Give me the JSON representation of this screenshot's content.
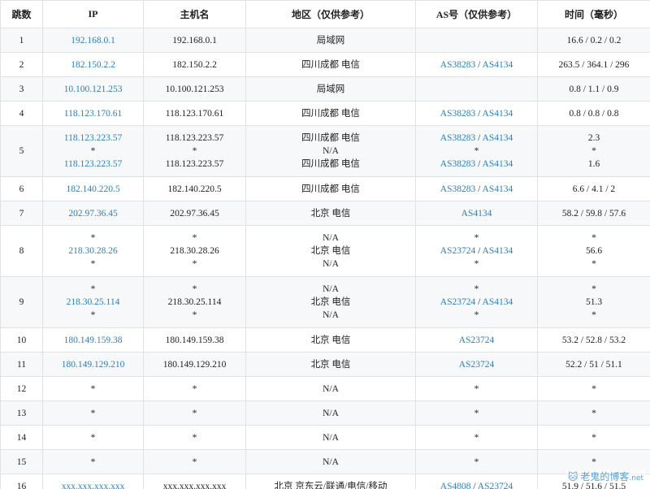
{
  "headers": [
    "跳数",
    "IP",
    "主机名",
    "地区（仅供参考）",
    "AS号（仅供参考）",
    "时间（毫秒）"
  ],
  "rows": [
    {
      "hop": "1",
      "ip": [
        "192.168.0.1"
      ],
      "host": [
        "192.168.0.1"
      ],
      "region": [
        "局域网"
      ],
      "as": [
        []
      ],
      "time": [
        "16.6 / 0.2 / 0.2"
      ]
    },
    {
      "hop": "2",
      "ip": [
        "182.150.2.2"
      ],
      "host": [
        "182.150.2.2"
      ],
      "region": [
        "四川成都 电信"
      ],
      "as": [
        [
          "AS38283",
          "AS4134"
        ]
      ],
      "time": [
        "263.5 / 364.1 / 296"
      ]
    },
    {
      "hop": "3",
      "ip": [
        "10.100.121.253"
      ],
      "host": [
        "10.100.121.253"
      ],
      "region": [
        "局域网"
      ],
      "as": [
        []
      ],
      "time": [
        "0.8 / 1.1 / 0.9"
      ]
    },
    {
      "hop": "4",
      "ip": [
        "118.123.170.61"
      ],
      "host": [
        "118.123.170.61"
      ],
      "region": [
        "四川成都 电信"
      ],
      "as": [
        [
          "AS38283",
          "AS4134"
        ]
      ],
      "time": [
        "0.8 / 0.8 / 0.8"
      ]
    },
    {
      "hop": "5",
      "ip": [
        "118.123.223.57",
        "*",
        "118.123.223.57"
      ],
      "host": [
        "118.123.223.57",
        "*",
        "118.123.223.57"
      ],
      "region": [
        "四川成都 电信",
        "N/A",
        "四川成都 电信"
      ],
      "as": [
        [
          "AS38283",
          "AS4134"
        ],
        [
          "*"
        ],
        [
          "AS38283",
          "AS4134"
        ]
      ],
      "time": [
        "2.3",
        "*",
        "1.6"
      ]
    },
    {
      "hop": "6",
      "ip": [
        "182.140.220.5"
      ],
      "host": [
        "182.140.220.5"
      ],
      "region": [
        "四川成都 电信"
      ],
      "as": [
        [
          "AS38283",
          "AS4134"
        ]
      ],
      "time": [
        "6.6 / 4.1 / 2"
      ]
    },
    {
      "hop": "7",
      "ip": [
        "202.97.36.45"
      ],
      "host": [
        "202.97.36.45"
      ],
      "region": [
        "北京 电信"
      ],
      "as": [
        [
          "AS4134"
        ]
      ],
      "time": [
        "58.2 / 59.8 / 57.6"
      ]
    },
    {
      "hop": "8",
      "ip": [
        "*",
        "218.30.28.26",
        "*"
      ],
      "host": [
        "*",
        "218.30.28.26",
        "*"
      ],
      "region": [
        "N/A",
        "北京 电信",
        "N/A"
      ],
      "as": [
        [
          "*"
        ],
        [
          "AS23724",
          "AS4134"
        ],
        [
          "*"
        ]
      ],
      "time": [
        "*",
        "56.6",
        "*"
      ]
    },
    {
      "hop": "9",
      "ip": [
        "*",
        "218.30.25.114",
        "*"
      ],
      "host": [
        "*",
        "218.30.25.114",
        "*"
      ],
      "region": [
        "N/A",
        "北京 电信",
        "N/A"
      ],
      "as": [
        [
          "*"
        ],
        [
          "AS23724",
          "AS4134"
        ],
        [
          "*"
        ]
      ],
      "time": [
        "*",
        "51.3",
        "*"
      ]
    },
    {
      "hop": "10",
      "ip": [
        "180.149.159.38"
      ],
      "host": [
        "180.149.159.38"
      ],
      "region": [
        "北京 电信"
      ],
      "as": [
        [
          "AS23724"
        ]
      ],
      "time": [
        "53.2 / 52.8 / 53.2"
      ]
    },
    {
      "hop": "11",
      "ip": [
        "180.149.129.210"
      ],
      "host": [
        "180.149.129.210"
      ],
      "region": [
        "北京 电信"
      ],
      "as": [
        [
          "AS23724"
        ]
      ],
      "time": [
        "52.2 / 51 / 51.1"
      ]
    },
    {
      "hop": "12",
      "ip": [
        "*"
      ],
      "host": [
        "*"
      ],
      "region": [
        "N/A"
      ],
      "as": [
        [
          "*"
        ]
      ],
      "time": [
        "*"
      ]
    },
    {
      "hop": "13",
      "ip": [
        "*"
      ],
      "host": [
        "*"
      ],
      "region": [
        "N/A"
      ],
      "as": [
        [
          "*"
        ]
      ],
      "time": [
        "*"
      ]
    },
    {
      "hop": "14",
      "ip": [
        "*"
      ],
      "host": [
        "*"
      ],
      "region": [
        "N/A"
      ],
      "as": [
        [
          "*"
        ]
      ],
      "time": [
        "*"
      ]
    },
    {
      "hop": "15",
      "ip": [
        "*"
      ],
      "host": [
        "*"
      ],
      "region": [
        "N/A"
      ],
      "as": [
        [
          "*"
        ]
      ],
      "time": [
        "*"
      ]
    },
    {
      "hop": "16",
      "ip": [
        "xxx.xxx.xxx.xxx"
      ],
      "host": [
        "xxx.xxx.xxx.xxx"
      ],
      "region": [
        "北京 京东云/联通/电信/移动"
      ],
      "as": [
        [
          "AS4808",
          "AS23724"
        ]
      ],
      "time": [
        "51.9 / 51.6 / 51.5"
      ]
    }
  ],
  "watermark": {
    "text": "老鬼的博客",
    "suffix": ".net"
  },
  "colors": {
    "link": "#2a7fc1",
    "stripe": "#f7f8fa",
    "border": "#e2e2e2"
  }
}
